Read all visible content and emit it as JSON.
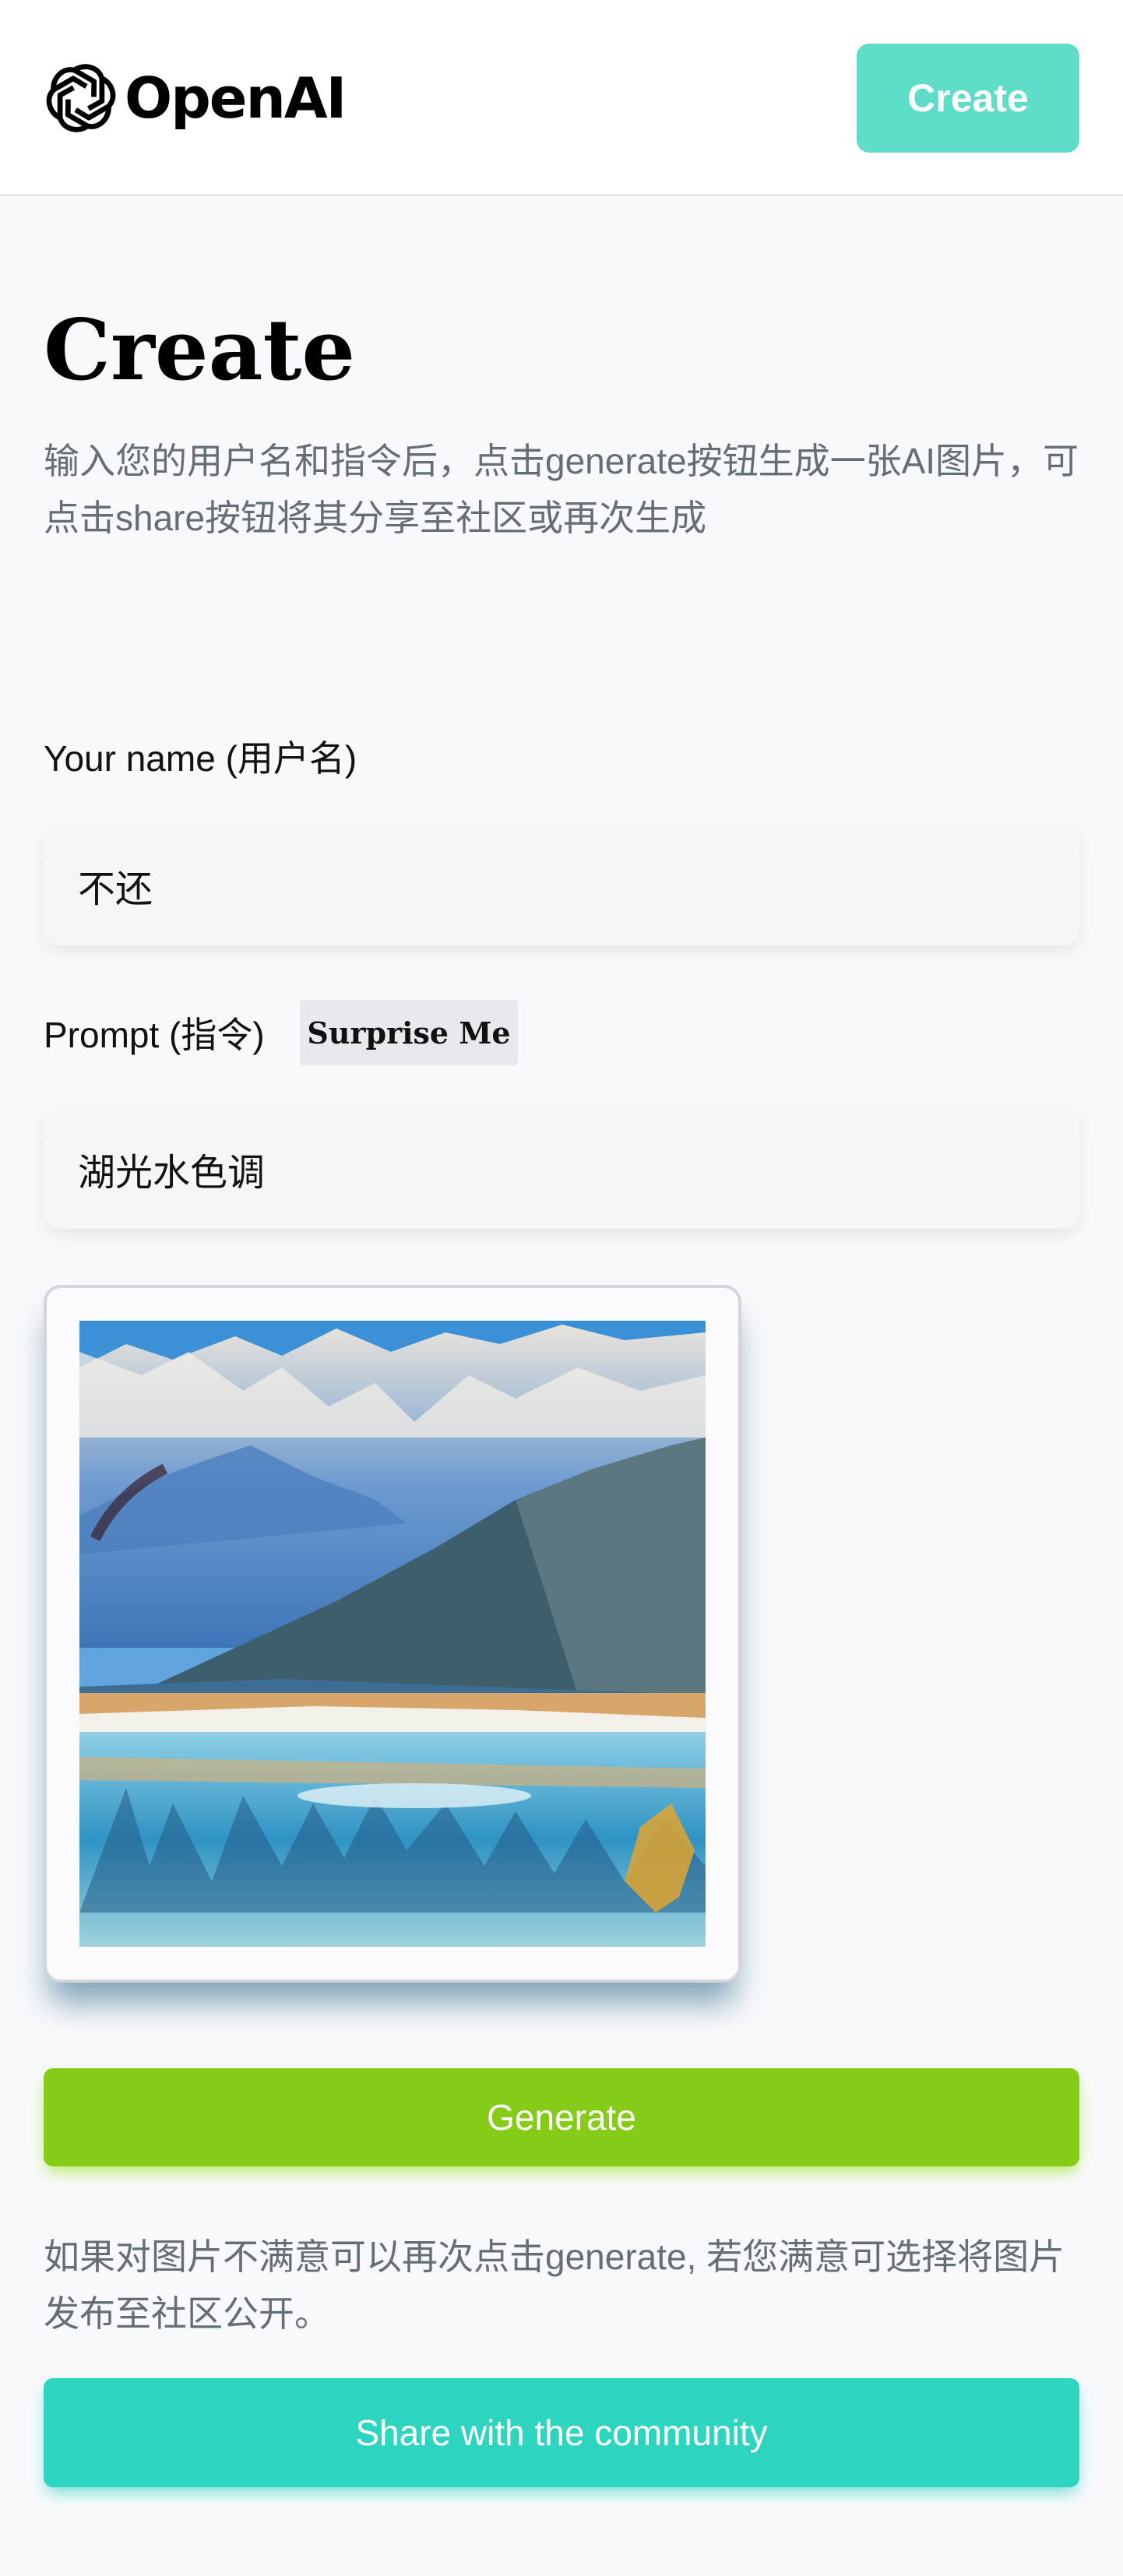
{
  "header": {
    "logo_text": "OpenAI",
    "logo_icon": "openai-logo-icon",
    "create_label": "Create"
  },
  "main": {
    "title": "Create",
    "description": "输入您的用户名和指令后，点击generate按钮生成一张AI图片，可点击share按钮将其分享至社区或再次生成"
  },
  "form": {
    "name_label": "Your name (用户名)",
    "name_value": "不还",
    "prompt_label": "Prompt (指令)",
    "surprise_label": "Surprise Me",
    "prompt_value": "湖光水色调"
  },
  "preview": {
    "image_description": "generated-image"
  },
  "actions": {
    "generate_label": "Generate",
    "note": "如果对图片不满意可以再次点击generate, 若您满意可选择将图片发布至社区公开。",
    "share_label": "Share with the community"
  },
  "colors": {
    "accent_create": "#5ddcc7",
    "generate": "#84cc16",
    "share": "#2dd4bf",
    "muted_text": "#666e75"
  }
}
